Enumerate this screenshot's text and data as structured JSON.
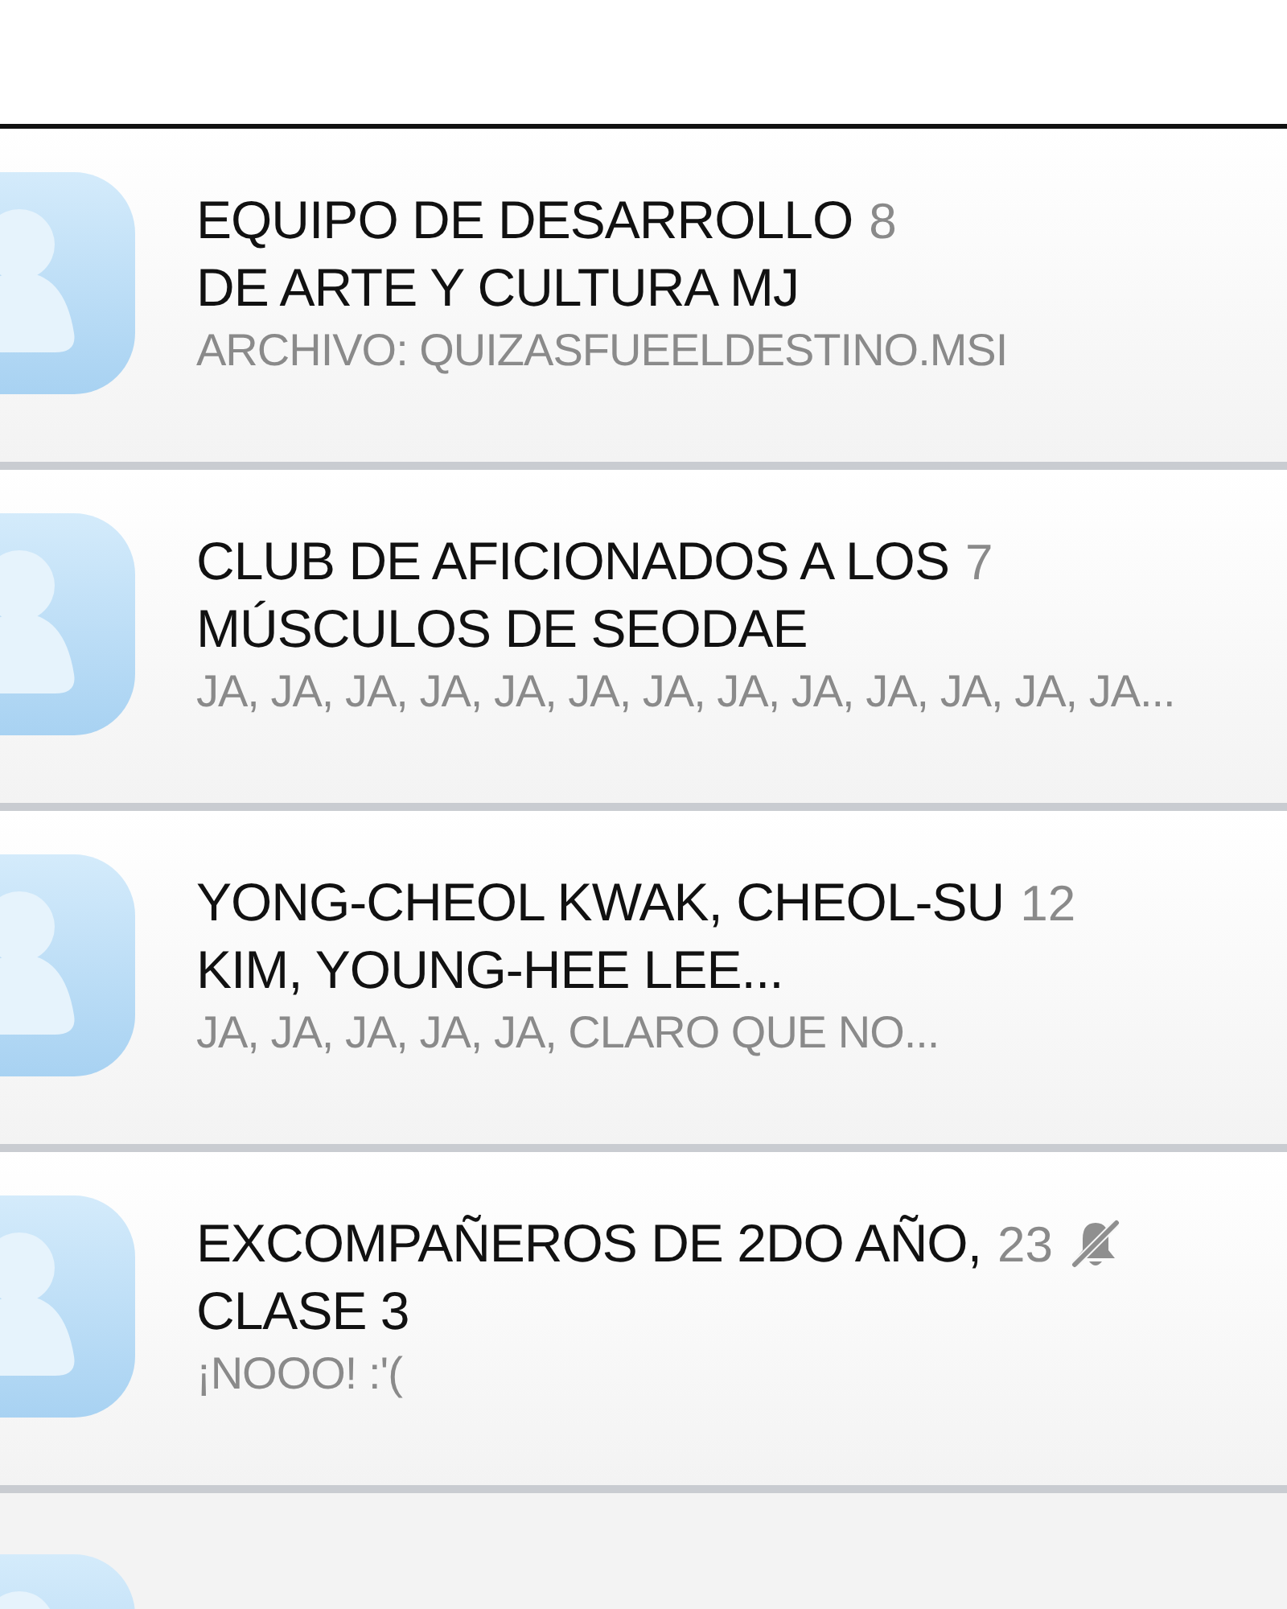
{
  "chats": [
    {
      "title": "EQUIPO DE DESARROLLO\nDE ARTE Y CULTURA MJ",
      "count": "8",
      "preview": "ARCHIVO: QUIZASFUEELDESTINO.MSI",
      "muted": false
    },
    {
      "title": "CLUB DE AFICIONADOS A LOS\nMÚSCULOS DE SEODAE",
      "count": "7",
      "preview": "JA, JA, JA, JA, JA, JA, JA, JA, JA, JA, JA, JA, JA...",
      "muted": false
    },
    {
      "title": "YONG-CHEOL KWAK, CHEOL-SU\nKIM, YOUNG-HEE LEE...",
      "count": "12",
      "preview": "JA, JA, JA, JA, JA, CLARO QUE NO...",
      "muted": false
    },
    {
      "title": "EXCOMPAÑEROS DE 2DO AÑO,\nCLASE 3",
      "count": "23",
      "preview": "¡NOOO! :'(",
      "muted": true
    }
  ]
}
